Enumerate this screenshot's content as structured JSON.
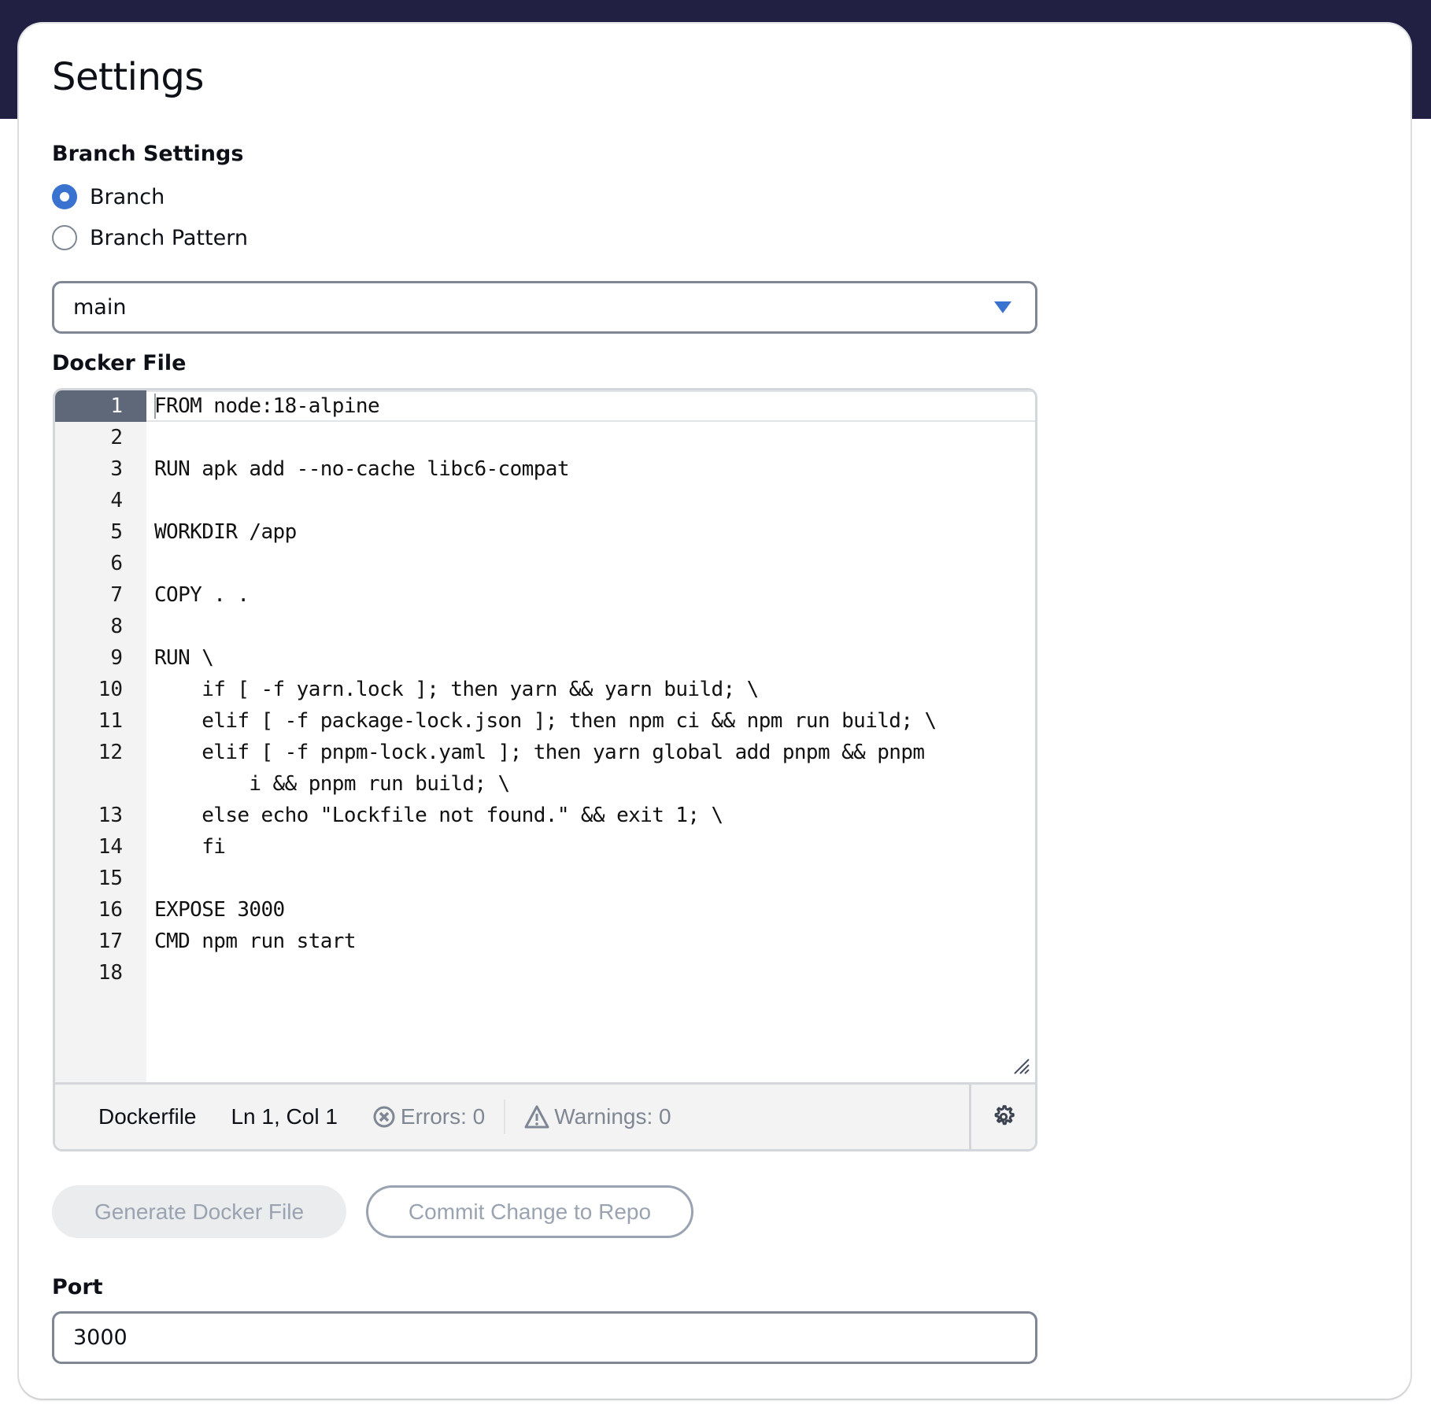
{
  "page": {
    "title": "Settings"
  },
  "branch_settings": {
    "label": "Branch Settings",
    "options": [
      {
        "label": "Branch",
        "checked": true
      },
      {
        "label": "Branch Pattern",
        "checked": false
      }
    ],
    "selected_branch": "main"
  },
  "docker_file": {
    "label": "Docker File",
    "lines": [
      {
        "n": "1",
        "text": "FROM node:18-alpine"
      },
      {
        "n": "2",
        "text": ""
      },
      {
        "n": "3",
        "text": "RUN apk add --no-cache libc6-compat"
      },
      {
        "n": "4",
        "text": ""
      },
      {
        "n": "5",
        "text": "WORKDIR /app"
      },
      {
        "n": "6",
        "text": ""
      },
      {
        "n": "7",
        "text": "COPY . ."
      },
      {
        "n": "8",
        "text": ""
      },
      {
        "n": "9",
        "text": "RUN \\"
      },
      {
        "n": "10",
        "text": "    if [ -f yarn.lock ]; then yarn && yarn build; \\"
      },
      {
        "n": "11",
        "text": "    elif [ -f package-lock.json ]; then npm ci && npm run build; \\"
      },
      {
        "n": "12",
        "text": "    elif [ -f pnpm-lock.yaml ]; then yarn global add pnpm && pnpm"
      },
      {
        "n": "",
        "text": "        i && pnpm run build; \\"
      },
      {
        "n": "13",
        "text": "    else echo \"Lockfile not found.\" && exit 1; \\"
      },
      {
        "n": "14",
        "text": "    fi"
      },
      {
        "n": "15",
        "text": ""
      },
      {
        "n": "16",
        "text": "EXPOSE 3000"
      },
      {
        "n": "17",
        "text": "CMD npm run start"
      },
      {
        "n": "18",
        "text": ""
      }
    ],
    "status": {
      "language": "Dockerfile",
      "position": "Ln 1, Col 1",
      "errors": "Errors: 0",
      "warnings": "Warnings: 0"
    }
  },
  "actions": {
    "generate_label": "Generate Docker File",
    "commit_label": "Commit Change to Repo"
  },
  "port": {
    "label": "Port",
    "value": "3000"
  },
  "colors": {
    "header_band": "#212042",
    "accent": "#3a72d0",
    "active_line_number_bg": "#5f6878",
    "muted_text": "#7f8794"
  }
}
